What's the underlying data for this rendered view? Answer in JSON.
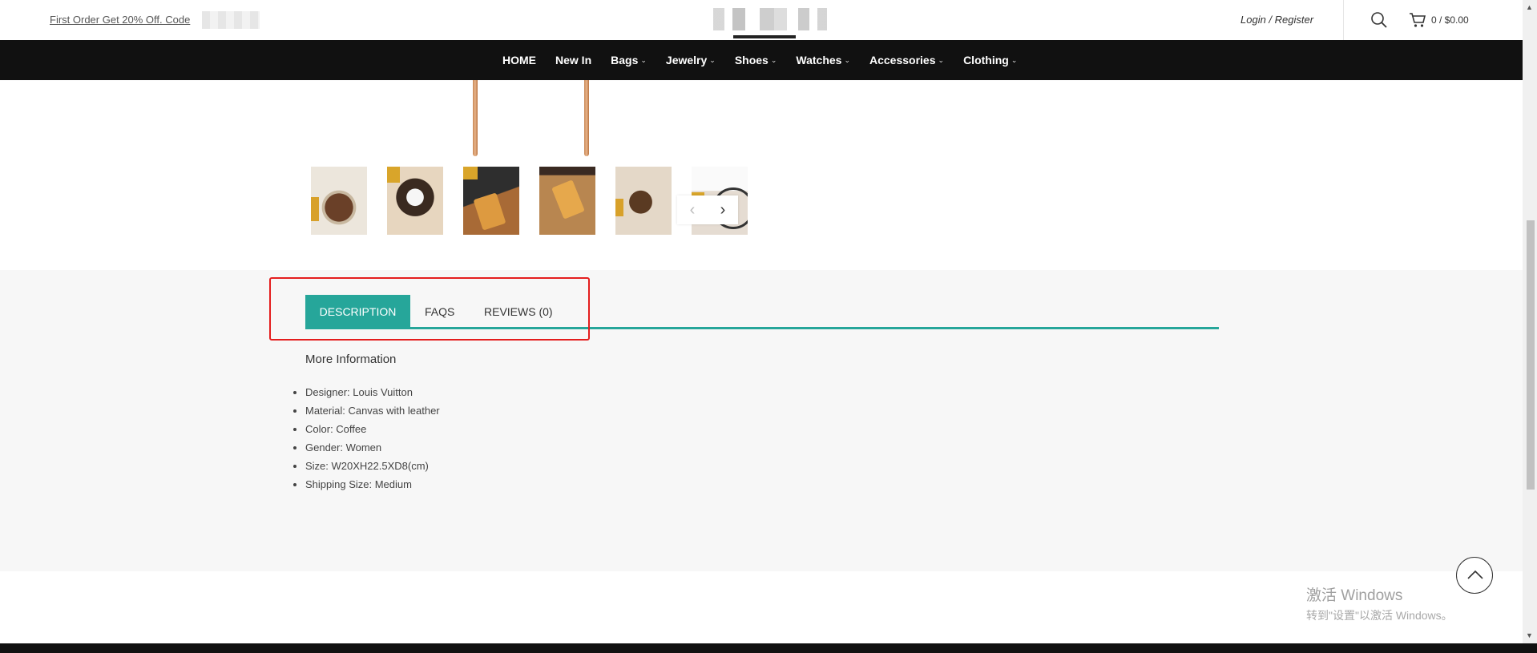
{
  "header": {
    "promo_text": "First Order Get 20% Off. Code",
    "login_register": "Login / Register",
    "cart_total": "0 / $0.00"
  },
  "nav": {
    "items": [
      {
        "label": "HOME",
        "dropdown": false
      },
      {
        "label": "New In",
        "dropdown": false
      },
      {
        "label": "Bags",
        "dropdown": true
      },
      {
        "label": "Jewelry",
        "dropdown": true
      },
      {
        "label": "Shoes",
        "dropdown": true
      },
      {
        "label": "Watches",
        "dropdown": true
      },
      {
        "label": "Accessories",
        "dropdown": true
      },
      {
        "label": "Clothing",
        "dropdown": true
      }
    ]
  },
  "gallery": {
    "prev_icon": "chevron-left-icon",
    "next_icon": "chevron-right-icon"
  },
  "tabs": [
    {
      "label": "DESCRIPTION",
      "active": true
    },
    {
      "label": "FAQS",
      "active": false
    },
    {
      "label": "REVIEWS (0)",
      "active": false
    }
  ],
  "description": {
    "heading": "More Information",
    "specs": [
      "Designer: Louis Vuitton",
      "Material: Canvas with leather",
      "Color: Coffee",
      "Gender: Women",
      "Size: W20XH22.5XD8(cm)",
      "Shipping Size: Medium"
    ]
  },
  "watermark": {
    "line1": "激活 Windows",
    "line2": "转到\"设置\"以激活 Windows。"
  },
  "colors": {
    "accent": "#26a69a",
    "nav_bg": "#111111",
    "highlight": "#e41e1e"
  }
}
